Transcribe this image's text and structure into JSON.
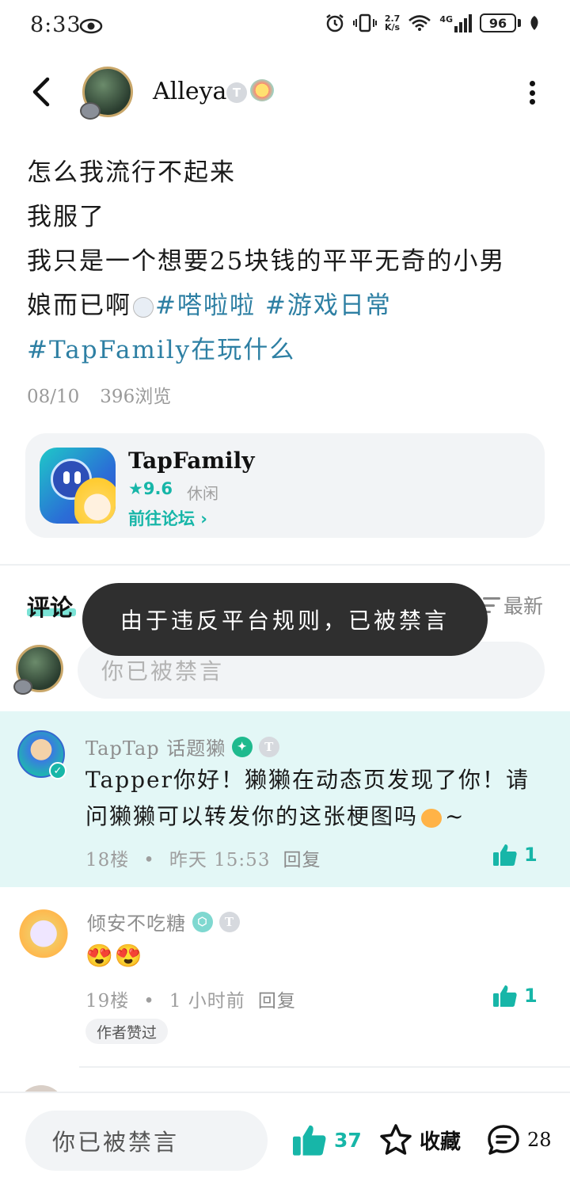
{
  "status_bar": {
    "time": "8:33",
    "net_speed_top": "2.7",
    "net_speed_bottom": "K/s",
    "network": "4G",
    "battery": "96"
  },
  "header": {
    "username": "Alleya",
    "badge": "T"
  },
  "post": {
    "lines": [
      "怎么我流行不起来",
      "我服了",
      "我只是一个想要25块钱的平平无奇的小男",
      "娘而已啊"
    ],
    "tags": [
      "#嗒啦啦",
      "#游戏日常",
      "#TapFamily在玩什么"
    ],
    "date": "08/10",
    "views": "396浏览"
  },
  "game_card": {
    "name": "TapFamily",
    "score": "9.6",
    "genre": "休闲",
    "link": "前往论坛"
  },
  "comments_section": {
    "title": "评论",
    "sort": "最新",
    "input_placeholder": "你已被禁言"
  },
  "toast": "由于违反平台规则，已被禁言",
  "comments": [
    {
      "author": "TapTap  话题獭",
      "text_line1": "Tapper你好！獭獭在动态页发现了你！请",
      "text_line2": "问獭獭可以转发你的这张梗图吗",
      "text_suffix": "~",
      "floor": "18楼",
      "time": "昨天  15:53",
      "reply": "回复",
      "likes": "1",
      "highlighted": true
    },
    {
      "author": "倾安不吃糖",
      "text": "😍😍",
      "floor": "19楼",
      "time": "1  小时前",
      "reply": "回复",
      "likes": "1",
      "tag": "作者赞过"
    }
  ],
  "bottom_bar": {
    "input_placeholder": "你已被禁言",
    "likes": "37",
    "favorite": "收藏",
    "comments": "28"
  },
  "colors": {
    "accent": "#17b6a8",
    "tag": "#2d7fa3",
    "highlight_bg": "#e3f7f6",
    "toast_bg": "#2f2f2f"
  }
}
